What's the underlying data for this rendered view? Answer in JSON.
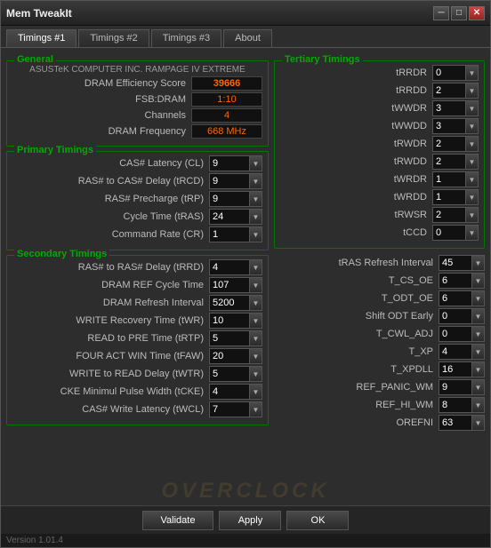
{
  "window": {
    "title": "Mem TweakIt",
    "minimize": "─",
    "maximize": "□",
    "close": "✕"
  },
  "tabs": [
    {
      "label": "Timings #1",
      "active": true
    },
    {
      "label": "Timings #2",
      "active": false
    },
    {
      "label": "Timings #3",
      "active": false
    },
    {
      "label": "About",
      "active": false
    }
  ],
  "general": {
    "label": "General",
    "mobo": "ASUSTeK COMPUTER INC. RAMPAGE IV EXTREME",
    "efficiency_label": "DRAM Efficiency Score",
    "efficiency_value": "39666",
    "fsb_label": "FSB:DRAM",
    "fsb_value": "1:10",
    "channels_label": "Channels",
    "channels_value": "4",
    "freq_label": "DRAM Frequency",
    "freq_value": "668 MHz"
  },
  "primary": {
    "label": "Primary Timings",
    "rows": [
      {
        "label": "CAS# Latency (CL)",
        "value": "9"
      },
      {
        "label": "RAS# to CAS# Delay (tRCD)",
        "value": "9"
      },
      {
        "label": "RAS# Precharge (tRP)",
        "value": "9"
      },
      {
        "label": "Cycle Time (tRAS)",
        "value": "24"
      },
      {
        "label": "Command Rate (CR)",
        "value": "1"
      }
    ]
  },
  "secondary": {
    "label": "Secondary Timings",
    "rows": [
      {
        "label": "RAS# to RAS# Delay (tRRD)",
        "value": "4"
      },
      {
        "label": "DRAM REF Cycle Time",
        "value": "107"
      },
      {
        "label": "DRAM Refresh Interval",
        "value": "5200"
      },
      {
        "label": "WRITE Recovery Time (tWR)",
        "value": "10"
      },
      {
        "label": "READ to PRE Time (tRTP)",
        "value": "5"
      },
      {
        "label": "FOUR ACT WIN Time (tFAW)",
        "value": "20"
      },
      {
        "label": "WRITE to READ Delay (tWTR)",
        "value": "5"
      },
      {
        "label": "CKE Minimul Pulse Width (tCKE)",
        "value": "4"
      },
      {
        "label": "CAS# Write Latency (tWCL)",
        "value": "7"
      }
    ]
  },
  "tertiary": {
    "label": "Tertiary Timings",
    "rows": [
      {
        "label": "tRRDR",
        "value": "0"
      },
      {
        "label": "tRRDD",
        "value": "2"
      },
      {
        "label": "tWWDR",
        "value": "3"
      },
      {
        "label": "tWWDD",
        "value": "3"
      },
      {
        "label": "tRWDR",
        "value": "2"
      },
      {
        "label": "tRWDD",
        "value": "2"
      },
      {
        "label": "tWRDR",
        "value": "1"
      },
      {
        "label": "tWRDD",
        "value": "1"
      },
      {
        "label": "tRWSR",
        "value": "2"
      },
      {
        "label": "tCCD",
        "value": "0"
      }
    ]
  },
  "extra": {
    "rows": [
      {
        "label": "tRAS Refresh Interval",
        "value": "45"
      },
      {
        "label": "T_CS_OE",
        "value": "6"
      },
      {
        "label": "T_ODT_OE",
        "value": "6"
      },
      {
        "label": "Shift ODT Early",
        "value": "0"
      },
      {
        "label": "T_CWL_ADJ",
        "value": "0"
      },
      {
        "label": "T_XP",
        "value": "4"
      },
      {
        "label": "T_XPDLL",
        "value": "16"
      },
      {
        "label": "REF_PANIC_WM",
        "value": "9"
      },
      {
        "label": "REF_HI_WM",
        "value": "8"
      },
      {
        "label": "OREFNI",
        "value": "63"
      }
    ]
  },
  "buttons": {
    "validate": "Validate",
    "apply": "Apply",
    "ok": "OK"
  },
  "version": "Version 1.01.4"
}
